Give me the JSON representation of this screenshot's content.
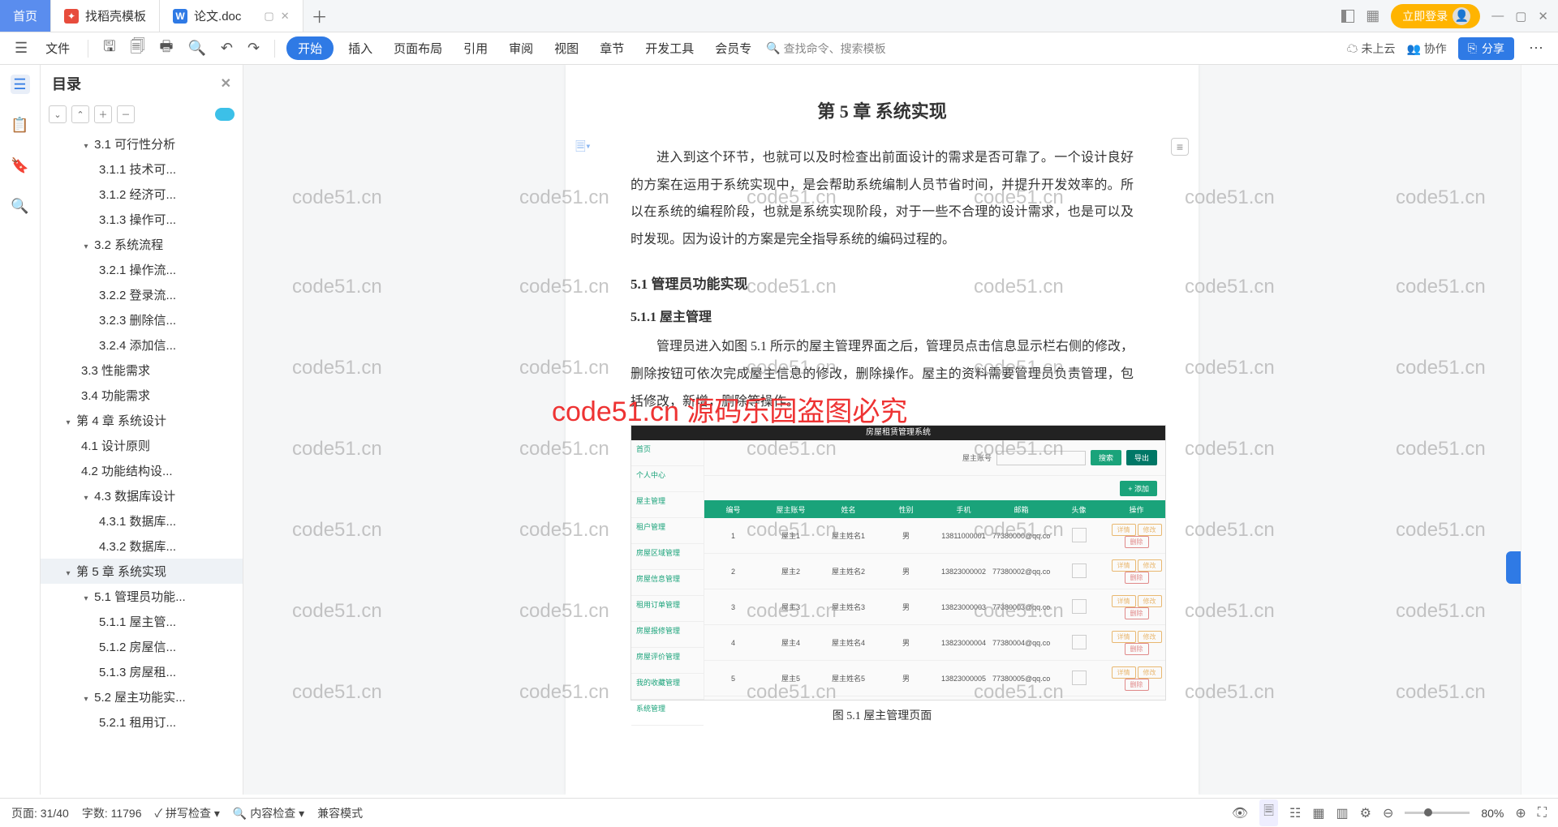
{
  "tabs": {
    "home": "首页",
    "template": "找稻壳模板",
    "doc": "论文.doc"
  },
  "titlebar": {
    "login": "立即登录"
  },
  "ribbon": {
    "file": "文件",
    "menus": [
      "开始",
      "插入",
      "页面布局",
      "引用",
      "审阅",
      "视图",
      "章节",
      "开发工具",
      "会员专"
    ],
    "search": "查找命令、搜索模板",
    "cloud": "未上云",
    "collab": "协作",
    "share": "分享"
  },
  "outline": {
    "title": "目录",
    "items": [
      {
        "lvl": 2,
        "caret": "▾",
        "text": "3.1  可行性分析"
      },
      {
        "lvl": 3,
        "text": "3.1.1 技术可..."
      },
      {
        "lvl": 3,
        "text": "3.1.2 经济可..."
      },
      {
        "lvl": 3,
        "text": "3.1.3 操作可..."
      },
      {
        "lvl": 2,
        "caret": "▾",
        "text": "3.2  系统流程"
      },
      {
        "lvl": 3,
        "text": "3.2.1 操作流..."
      },
      {
        "lvl": 3,
        "text": "3.2.2 登录流..."
      },
      {
        "lvl": 3,
        "text": "3.2.3 删除信..."
      },
      {
        "lvl": 3,
        "text": "3.2.4 添加信..."
      },
      {
        "lvl": 2,
        "text": "3.3 性能需求"
      },
      {
        "lvl": 2,
        "text": "3.4 功能需求"
      },
      {
        "lvl": 1,
        "caret": "▾",
        "text": "第 4 章  系统设计"
      },
      {
        "lvl": 2,
        "text": "4.1 设计原则"
      },
      {
        "lvl": 2,
        "text": "4.2 功能结构设..."
      },
      {
        "lvl": 2,
        "caret": "▾",
        "text": "4.3 数据库设计"
      },
      {
        "lvl": 3,
        "text": "4.3.1 数据库..."
      },
      {
        "lvl": 3,
        "text": "4.3.2 数据库..."
      },
      {
        "lvl": 1,
        "caret": "▾",
        "text": "第 5 章  系统实现",
        "sel": true
      },
      {
        "lvl": 2,
        "caret": "▾",
        "text": "5.1 管理员功能..."
      },
      {
        "lvl": 3,
        "text": "5.1.1 屋主管..."
      },
      {
        "lvl": 3,
        "text": "5.1.2 房屋信..."
      },
      {
        "lvl": 3,
        "text": "5.1.3 房屋租..."
      },
      {
        "lvl": 2,
        "caret": "▾",
        "text": "5.2 屋主功能实..."
      },
      {
        "lvl": 3,
        "text": "5.2.1 租用订..."
      }
    ]
  },
  "doc": {
    "chapter": "第 5 章  系统实现",
    "intro": "进入到这个环节，也就可以及时检查出前面设计的需求是否可靠了。一个设计良好的方案在运用于系统实现中，是会帮助系统编制人员节省时间，并提升开发效率的。所以在系统的编程阶段，也就是系统实现阶段，对于一些不合理的设计需求，也是可以及时发现。因为设计的方案是完全指导系统的编码过程的。",
    "h51": "5.1  管理员功能实现",
    "h511": "5.1.1  屋主管理",
    "p511a": "管理员进入如图 5.1 所示的屋主管理界面之后，管理员点击信息显示栏右侧的修改，删除按钮可依次完成屋主信息的修改，删除操作。屋主的资料需要管理员负责管理，包括修改，新增，删除等操作。",
    "figcap": "图 5.1  屋主管理页面",
    "shot": {
      "title": "房屋租赁管理系统",
      "side": [
        "首页",
        "个人中心",
        "屋主管理",
        "租户管理",
        "房屋区域管理",
        "房屋信息管理",
        "租用订单管理",
        "房屋报修管理",
        "房屋评价管理",
        "我的收藏管理",
        "系统管理"
      ],
      "filterLabel": "屋主账号",
      "search": "搜索",
      "export": "导出",
      "add": "+ 添加",
      "thead": [
        "编号",
        "屋主账号",
        "姓名",
        "性别",
        "手机",
        "邮箱",
        "头像",
        "操作"
      ],
      "rows": [
        [
          "1",
          "屋主1",
          "屋主姓名1",
          "男",
          "13811000001",
          "77380000@qq.com"
        ],
        [
          "2",
          "屋主2",
          "屋主姓名2",
          "男",
          "13823000002",
          "77380002@qq.com"
        ],
        [
          "3",
          "屋主3",
          "屋主姓名3",
          "男",
          "13823000003",
          "77380003@qq.com"
        ],
        [
          "4",
          "屋主4",
          "屋主姓名4",
          "男",
          "13823000004",
          "77380004@qq.com"
        ],
        [
          "5",
          "屋主5",
          "屋主姓名5",
          "男",
          "13823000005",
          "77380005@qq.com"
        ]
      ],
      "ops": [
        "详情",
        "修改",
        "删除"
      ]
    }
  },
  "watermarks": {
    "text": "code51.cn",
    "red1": "code51.cn",
    "red2": "源码乐园盗图必究"
  },
  "status": {
    "page": "页面: 31/40",
    "words": "字数: 11796",
    "spell": "拼写检查",
    "content": "内容检查",
    "compat": "兼容模式",
    "zoom": "80%"
  }
}
